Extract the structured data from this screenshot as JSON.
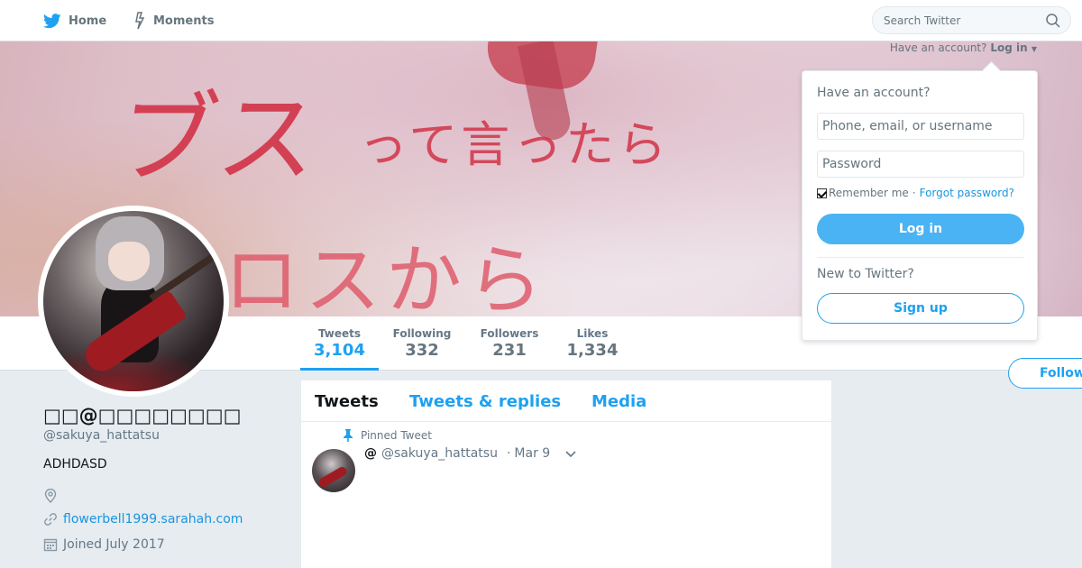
{
  "colors": {
    "accent": "#1da1f2",
    "text_primary": "#14171a",
    "text_secondary": "#657786",
    "background": "#e6ecf0",
    "link": "#1b95e0"
  },
  "topnav": {
    "home_label": "Home",
    "home_icon": "twitter-bird-icon",
    "moments_label": "Moments",
    "moments_icon": "lightning-icon",
    "search_placeholder": "Search Twitter",
    "search_icon": "search-icon"
  },
  "banner": {
    "text_line1": "ブス",
    "text_line1b": "って言ったら",
    "text_line2": "ロスから",
    "have_account_text": "Have an account?",
    "login_link": "Log in"
  },
  "profile_stats": [
    {
      "label": "Tweets",
      "value": "3,104"
    },
    {
      "label": "Following",
      "value": "332"
    },
    {
      "label": "Followers",
      "value": "231"
    },
    {
      "label": "Likes",
      "value": "1,334"
    }
  ],
  "follow_label": "Follow",
  "profile": {
    "name": "□□@□□□□□□□□",
    "handle": "@sakuya_hattatsu",
    "bio": "ADHDASD",
    "location": "",
    "url": "flowerbell1999.sarahah.com",
    "joined": "Joined July 2017"
  },
  "timeline": {
    "tabs": [
      "Tweets",
      "Tweets & replies",
      "Media"
    ],
    "pinned_label": "Pinned Tweet",
    "tweet": {
      "fullname": "@",
      "handle": "@sakuya_hattatsu",
      "date": "Mar 9"
    }
  },
  "login_dropdown": {
    "title": "Have an account?",
    "username_placeholder": "Phone, email, or username",
    "password_placeholder": "Password",
    "remember_label": "Remember me",
    "separator": "·",
    "forgot_label": "Forgot password?",
    "login_button": "Log in",
    "new_title": "New to Twitter?",
    "signup_button": "Sign up"
  }
}
